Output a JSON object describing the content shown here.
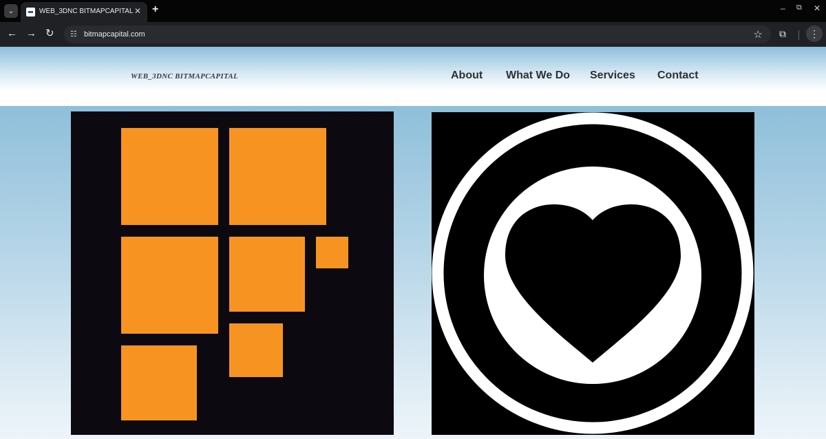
{
  "browser": {
    "tab_title": "WEB_3DNC BITMAPCAPITAL",
    "url": "bitmapcapital.com",
    "icons": {
      "tab_list": "⌄",
      "close": "✕",
      "new_tab": "+",
      "minimize": "–",
      "restore": "⧉",
      "close_window": "✕",
      "back": "←",
      "forward": "→",
      "reload": "↻",
      "site_info": "☷",
      "bookmark": "☆",
      "extensions": "⧉",
      "menu": "⋮"
    }
  },
  "site": {
    "brand": "WEB_3DNC BITMAPCAPITAL",
    "nav": [
      "About",
      "What We Do",
      "Services",
      "Contact"
    ],
    "colors": {
      "logo_orange": "#f79421",
      "logo_background": "#0c0a10",
      "heart_card_background": "#000000",
      "ring_color": "#ffffff"
    },
    "images": {
      "left": "bitmap-squares-logo",
      "right": "heart-in-circle-icon"
    }
  }
}
